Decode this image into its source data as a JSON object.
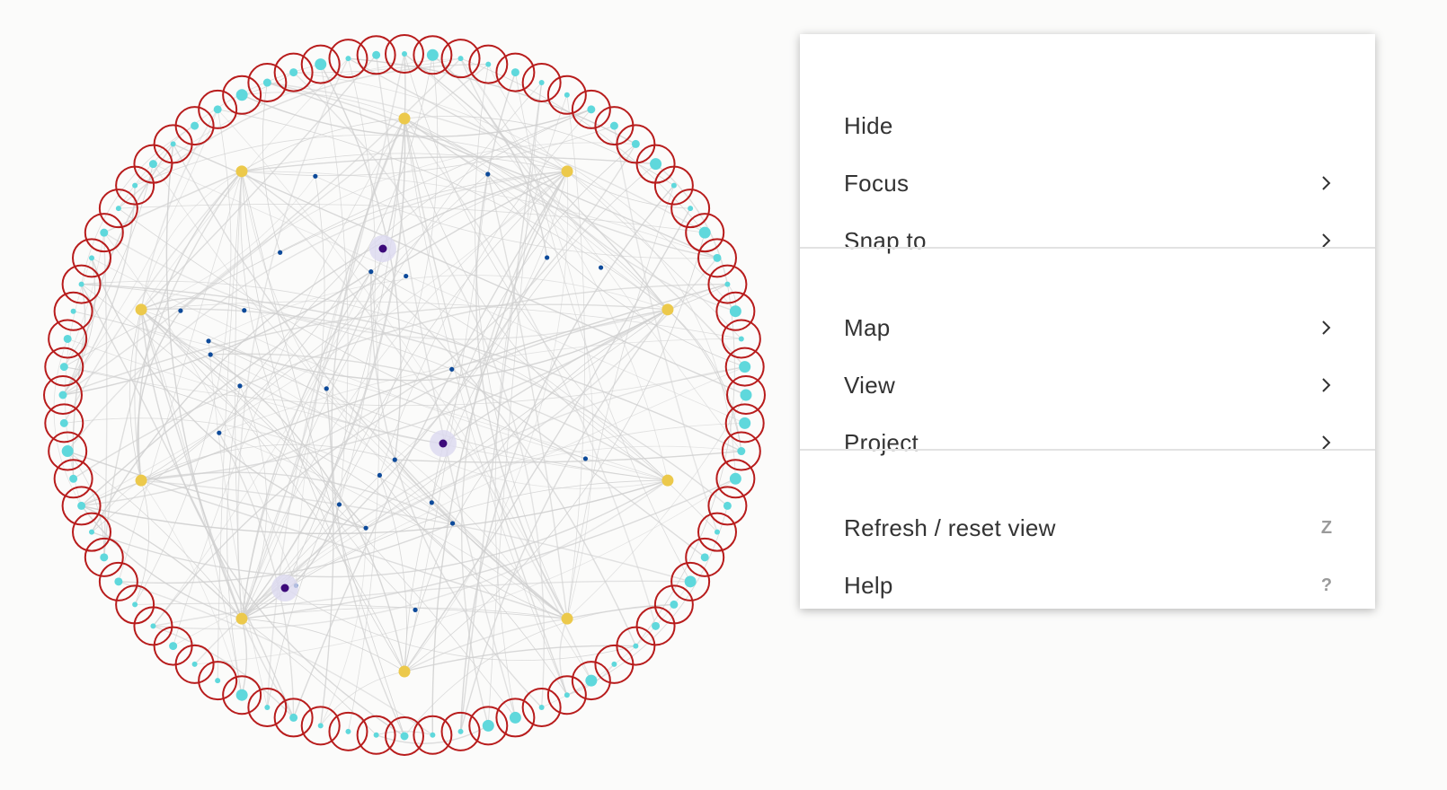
{
  "graph": {
    "ring_node_count": 76,
    "hub_node_count": 10,
    "inner_node_count": 24,
    "highlighted_node_count": 3,
    "colors": {
      "ring_node": "#5fd8dc",
      "ring_highlight": "#b81c1c",
      "hub_node": "#ecc94b",
      "inner_node": "#0d4a9a",
      "highlighted_node": "#3c0a7a",
      "highlight_halo": "#dcdaf0",
      "edge": "#cfcfcf"
    }
  },
  "menu": {
    "sections": [
      {
        "items": [
          {
            "label": "Hide",
            "submenu": false
          },
          {
            "label": "Focus",
            "submenu": true
          },
          {
            "label": "Snap to",
            "submenu": true
          }
        ]
      },
      {
        "items": [
          {
            "label": "Map",
            "submenu": true
          },
          {
            "label": "View",
            "submenu": true
          },
          {
            "label": "Project",
            "submenu": true
          }
        ]
      },
      {
        "items": [
          {
            "label": "Refresh / reset view",
            "shortcut": "Z"
          },
          {
            "label": "Help",
            "shortcut": "?"
          }
        ]
      }
    ]
  }
}
